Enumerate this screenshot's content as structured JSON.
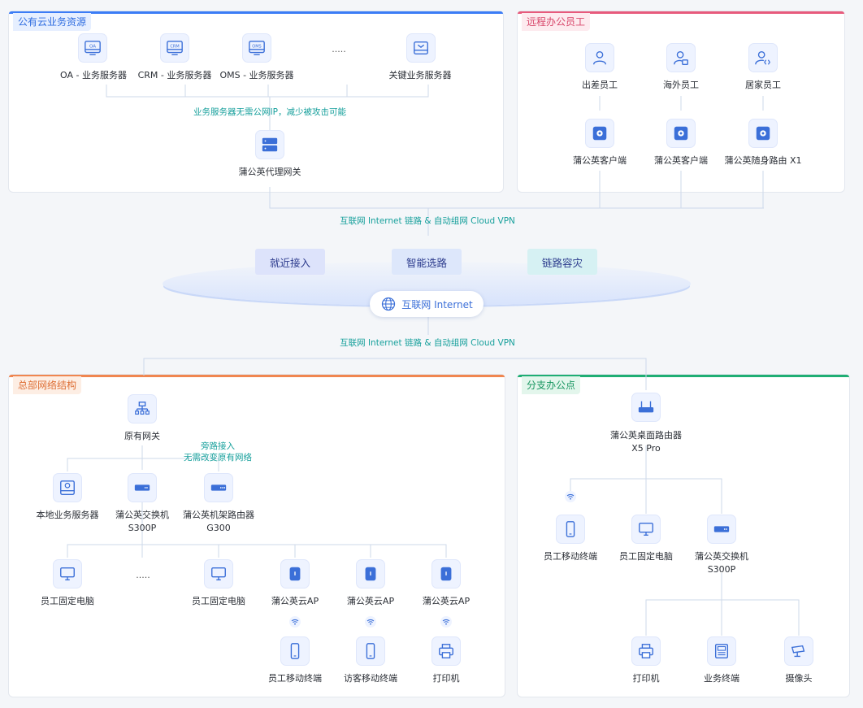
{
  "panels": {
    "cloud": {
      "title": "公有云业务资源",
      "color": "#3b7cf6"
    },
    "remote": {
      "title": "远程办公员工",
      "color": "#e75a7c"
    },
    "hq": {
      "title": "总部网络结构",
      "color": "#f08650"
    },
    "branch": {
      "title": "分支办公点",
      "color": "#1fae74"
    }
  },
  "cloud_section": {
    "servers": [
      {
        "label": "OA - 业务服务器",
        "icon": "oa-server-icon",
        "badge": "OA"
      },
      {
        "label": "CRM - 业务服务器",
        "icon": "crm-server-icon",
        "badge": "CRM"
      },
      {
        "label": "OMS - 业务服务器",
        "icon": "oms-server-icon",
        "badge": "OMS"
      },
      {
        "label": "关键业务服务器",
        "icon": "key-server-icon",
        "badge": ""
      }
    ],
    "ellipsis": ".....",
    "note": "业务服务器无需公网IP，减少被攻击可能",
    "gateway": {
      "label": "蒲公英代理网关",
      "icon": "proxy-gateway-icon"
    }
  },
  "remote_section": {
    "users": [
      {
        "label": "出差员工",
        "icon": "user-travel-icon"
      },
      {
        "label": "海外员工",
        "icon": "user-overseas-icon"
      },
      {
        "label": "居家员工",
        "icon": "user-home-icon"
      }
    ],
    "clients": [
      {
        "label": "蒲公英客户端",
        "icon": "pgy-client-icon"
      },
      {
        "label": "蒲公英客户端",
        "icon": "pgy-client-icon"
      },
      {
        "label": "蒲公英随身路由 X1",
        "icon": "pgy-x1-router-icon"
      }
    ]
  },
  "middle": {
    "link_top": "互联网 Internet 链路 & 自动组网 Cloud VPN",
    "features": [
      {
        "label": "就近接入",
        "bg": "#dde3fb"
      },
      {
        "label": "智能选路",
        "bg": "#dde7fb"
      },
      {
        "label": "链路容灾",
        "bg": "#d6f1f3"
      }
    ],
    "internet": "互联网 Internet",
    "link_bottom": "互联网 Internet 链路 & 自动组网 Cloud VPN"
  },
  "hq_section": {
    "gateway": {
      "label": "原有网关",
      "icon": "gateway-icon"
    },
    "note_line1": "旁路接入",
    "note_line2": "无需改变原有网络",
    "row2": [
      {
        "label": "本地业务服务器",
        "icon": "local-server-icon"
      },
      {
        "label": "蒲公英交换机\nS300P",
        "icon": "switch-icon"
      },
      {
        "label": "蒲公英机架路由器\nG300",
        "icon": "rack-router-icon"
      }
    ],
    "row3": [
      {
        "label": "员工固定电脑",
        "icon": "desktop-icon"
      },
      {
        "label": "员工固定电脑",
        "icon": "desktop-icon"
      },
      {
        "label": "蒲公英云AP",
        "icon": "cloud-ap-icon"
      },
      {
        "label": "蒲公英云AP",
        "icon": "cloud-ap-icon"
      },
      {
        "label": "蒲公英云AP",
        "icon": "cloud-ap-icon"
      }
    ],
    "ellipsis": ".....",
    "row4": [
      {
        "label": "员工移动终端",
        "icon": "mobile-icon"
      },
      {
        "label": "访客移动终端",
        "icon": "mobile-icon"
      },
      {
        "label": "打印机",
        "icon": "printer-icon"
      }
    ]
  },
  "branch_section": {
    "router": {
      "label": "蒲公英桌面路由器\nX5 Pro",
      "icon": "desktop-router-icon"
    },
    "row2": [
      {
        "label": "员工移动终端",
        "icon": "mobile-icon"
      },
      {
        "label": "员工固定电脑",
        "icon": "desktop-icon"
      },
      {
        "label": "蒲公英交换机\nS300P",
        "icon": "switch-icon"
      }
    ],
    "row3": [
      {
        "label": "打印机",
        "icon": "printer-icon"
      },
      {
        "label": "业务终端",
        "icon": "business-terminal-icon"
      },
      {
        "label": "摄像头",
        "icon": "camera-icon"
      }
    ]
  }
}
